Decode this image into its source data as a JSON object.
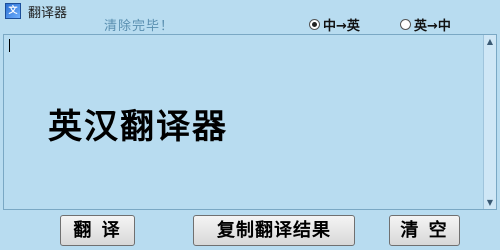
{
  "window": {
    "title": "翻译器",
    "icon": "translator-app-icon"
  },
  "status": {
    "message": "清除完毕！"
  },
  "direction": {
    "options": [
      {
        "label": "中→英",
        "checked": true
      },
      {
        "label": "英→中",
        "checked": false
      }
    ]
  },
  "editor": {
    "content": "英汉翻译器"
  },
  "buttons": {
    "translate": "翻 译",
    "copy_result": "复制翻译结果",
    "clear": "清 空"
  }
}
